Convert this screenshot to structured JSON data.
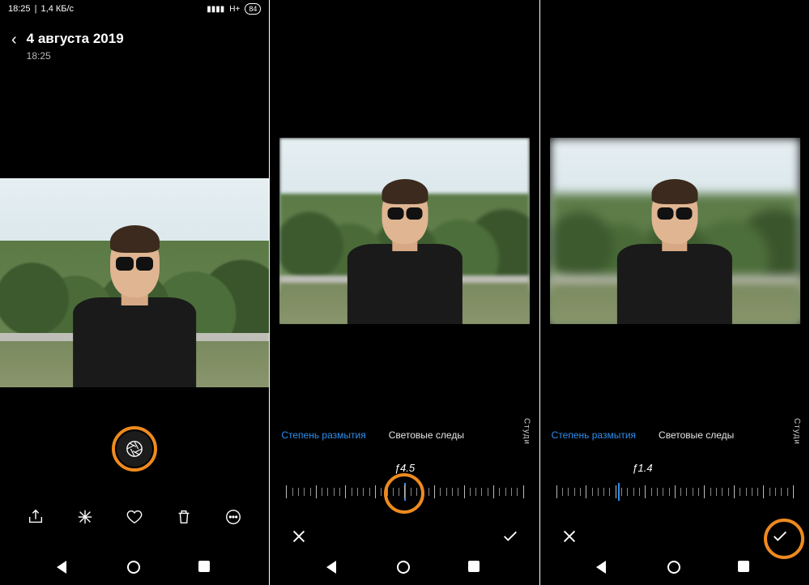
{
  "status": {
    "time": "18:25",
    "speed": "1,4 КБ/с",
    "net": "H+",
    "battery": "84"
  },
  "header": {
    "date": "4 августа 2019",
    "time": "18:25"
  },
  "toolbar": {
    "share": "share",
    "effects": "effects",
    "favorite": "favorite",
    "delete": "delete",
    "more": "more"
  },
  "edit": {
    "tab_blur": "Степень размытия",
    "tab_light": "Световые следы",
    "tab_studio": "Студи",
    "f_mid": "ƒ4.5",
    "f_low": "ƒ1.4"
  },
  "nav": {
    "back": "back",
    "home": "home",
    "recent": "recent"
  }
}
